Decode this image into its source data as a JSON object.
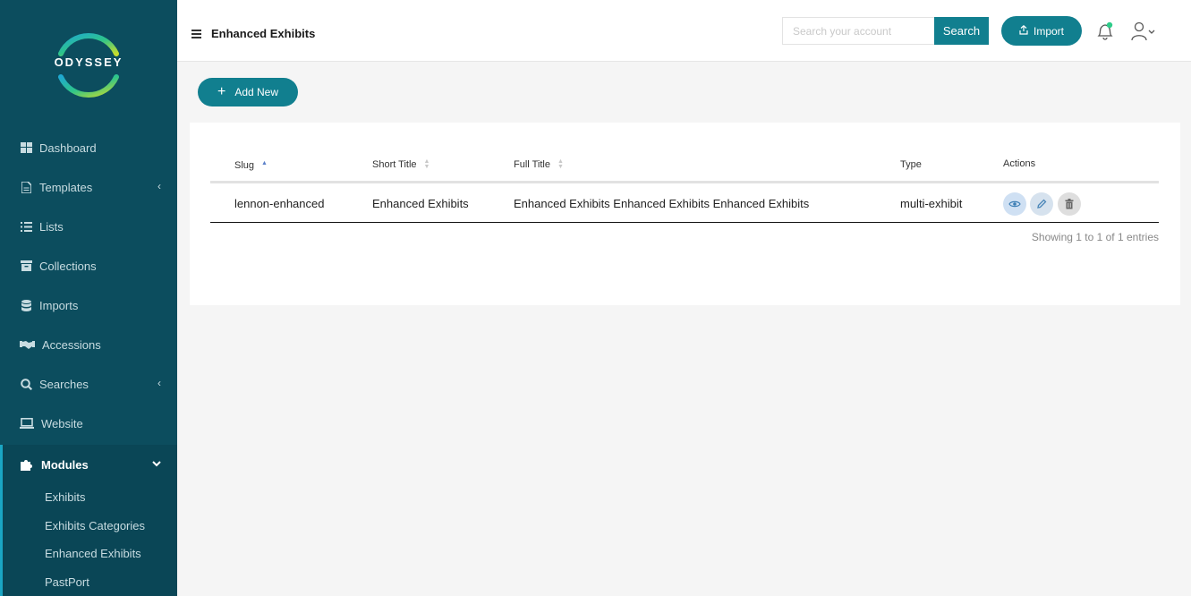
{
  "brand": {
    "name": "ODYSSEY"
  },
  "sidebar": {
    "items": [
      {
        "label": "Dashboard",
        "icon": "dashboard-icon",
        "has_chevron": false
      },
      {
        "label": "Templates",
        "icon": "file-icon",
        "has_chevron": true
      },
      {
        "label": "Lists",
        "icon": "list-icon",
        "has_chevron": false
      },
      {
        "label": "Collections",
        "icon": "archive-icon",
        "has_chevron": false
      },
      {
        "label": "Imports",
        "icon": "database-icon",
        "has_chevron": false
      },
      {
        "label": "Accessions",
        "icon": "handshake-icon",
        "has_chevron": false
      },
      {
        "label": "Searches",
        "icon": "search-icon",
        "has_chevron": true
      },
      {
        "label": "Website",
        "icon": "laptop-icon",
        "has_chevron": false
      },
      {
        "label": "Modules",
        "icon": "puzzle-icon",
        "has_chevron": true,
        "active": true
      }
    ],
    "subitems": [
      "Exhibits",
      "Exhibits Categories",
      "Enhanced Exhibits",
      "PastPort"
    ]
  },
  "header": {
    "title": "Enhanced Exhibits",
    "search_placeholder": "Search your account",
    "search_label": "Search",
    "import_label": "Import"
  },
  "add_new_label": "Add New",
  "table": {
    "columns": [
      "Slug",
      "Short Title",
      "Full Title",
      "Type",
      "Actions"
    ],
    "rows": [
      {
        "slug": "lennon-enhanced",
        "short_title": "Enhanced Exhibits",
        "full_title": "Enhanced Exhibits Enhanced Exhibits Enhanced Exhibits",
        "type": "multi-exhibit"
      }
    ],
    "info": "Showing 1 to 1 of 1 entries"
  },
  "colors": {
    "sidebar_bg": "#0c4d5e",
    "accent": "#117f8f",
    "notification_dot": "#2ecc8a"
  }
}
